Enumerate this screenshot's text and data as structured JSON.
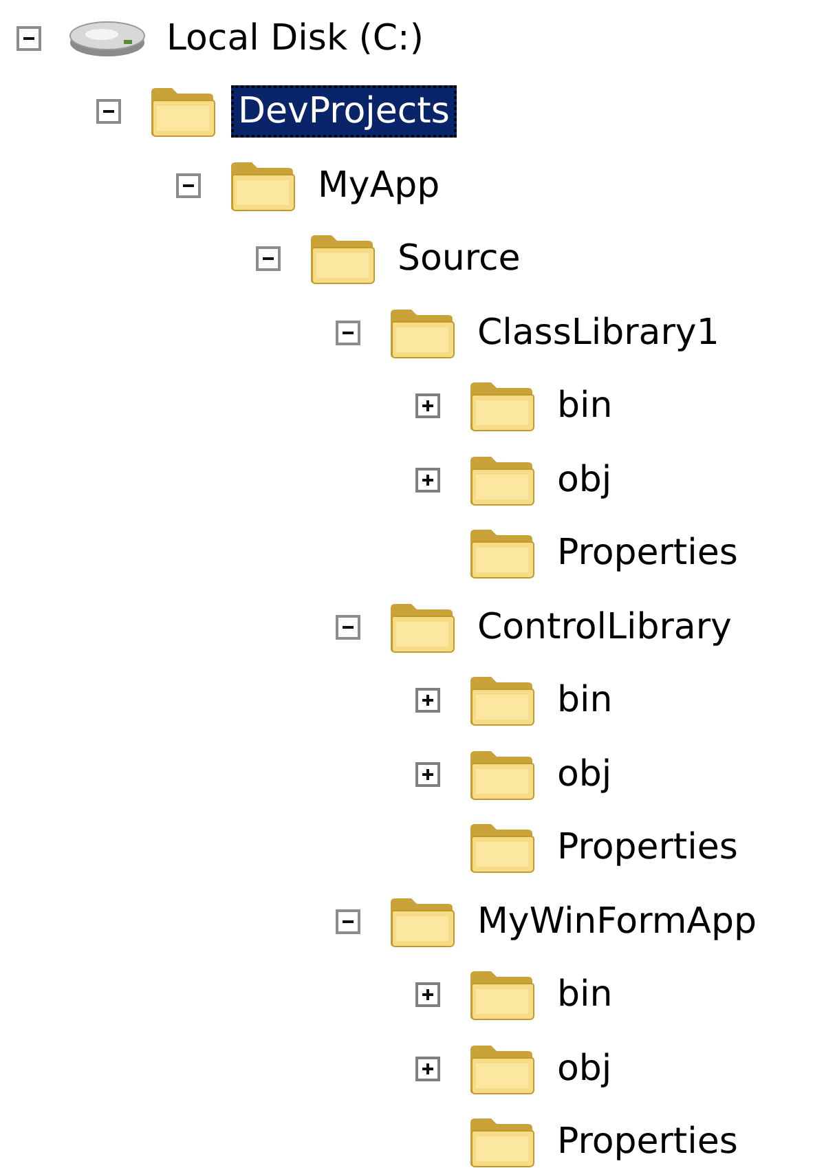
{
  "tree": [
    {
      "label": "Local Disk (C:)",
      "kind": "drive",
      "selected": false,
      "expandable": true,
      "expanded": true,
      "children": [
        {
          "label": "DevProjects",
          "kind": "folder",
          "selected": true,
          "expandable": true,
          "expanded": true,
          "children": [
            {
              "label": "MyApp",
              "kind": "folder",
              "selected": false,
              "expandable": true,
              "expanded": true,
              "children": [
                {
                  "label": "Source",
                  "kind": "folder",
                  "selected": false,
                  "expandable": true,
                  "expanded": true,
                  "children": [
                    {
                      "label": "ClassLibrary1",
                      "kind": "folder",
                      "selected": false,
                      "expandable": true,
                      "expanded": true,
                      "children": [
                        {
                          "label": "bin",
                          "kind": "folder",
                          "selected": false,
                          "expandable": true,
                          "expanded": false
                        },
                        {
                          "label": "obj",
                          "kind": "folder",
                          "selected": false,
                          "expandable": true,
                          "expanded": false
                        },
                        {
                          "label": "Properties",
                          "kind": "folder",
                          "selected": false,
                          "expandable": false
                        }
                      ]
                    },
                    {
                      "label": "ControlLibrary",
                      "kind": "folder",
                      "selected": false,
                      "expandable": true,
                      "expanded": true,
                      "children": [
                        {
                          "label": "bin",
                          "kind": "folder",
                          "selected": false,
                          "expandable": true,
                          "expanded": false
                        },
                        {
                          "label": "obj",
                          "kind": "folder",
                          "selected": false,
                          "expandable": true,
                          "expanded": false
                        },
                        {
                          "label": "Properties",
                          "kind": "folder",
                          "selected": false,
                          "expandable": false
                        }
                      ]
                    },
                    {
                      "label": "MyWinFormApp",
                      "kind": "folder",
                      "selected": false,
                      "expandable": true,
                      "expanded": true,
                      "children": [
                        {
                          "label": "bin",
                          "kind": "folder",
                          "selected": false,
                          "expandable": true,
                          "expanded": false
                        },
                        {
                          "label": "obj",
                          "kind": "folder",
                          "selected": false,
                          "expandable": true,
                          "expanded": false
                        },
                        {
                          "label": "Properties",
                          "kind": "folder",
                          "selected": false,
                          "expandable": false
                        }
                      ]
                    }
                  ]
                }
              ]
            }
          ]
        }
      ]
    }
  ]
}
